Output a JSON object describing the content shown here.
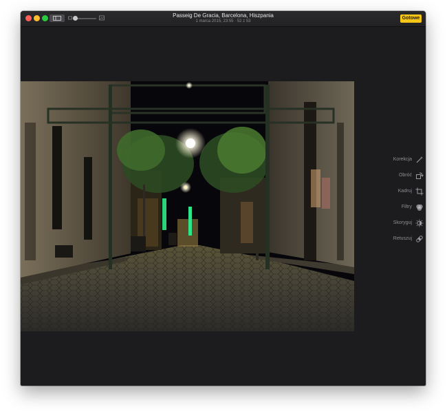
{
  "window": {
    "title": "Passeig De Gracia, Barcelona, Hiszpania",
    "subtitle": "1 marca 2015, 23:55 · 52 z 53",
    "done_label": "Gotowe"
  },
  "toolbar": {
    "icons": [
      "sidebar-toggle-icon",
      "zoom-out-icon",
      "zoom-slider",
      "zoom-in-icon"
    ],
    "zoom_level": 0.05
  },
  "photo": {
    "description_icon": "photo"
  },
  "tools": [
    {
      "label": "Korekcja",
      "icon": "magic-wand-icon"
    },
    {
      "label": "Obróć",
      "icon": "rotate-icon"
    },
    {
      "label": "Kadruj",
      "icon": "crop-icon"
    },
    {
      "label": "Filtry",
      "icon": "filters-icon"
    },
    {
      "label": "Skoryguj",
      "icon": "adjust-icon"
    },
    {
      "label": "Retuszuj",
      "icon": "bandage-icon"
    }
  ],
  "colors": {
    "accent": "#f5c518",
    "window_bg": "#1c1c1e",
    "label": "#8e8e93"
  }
}
